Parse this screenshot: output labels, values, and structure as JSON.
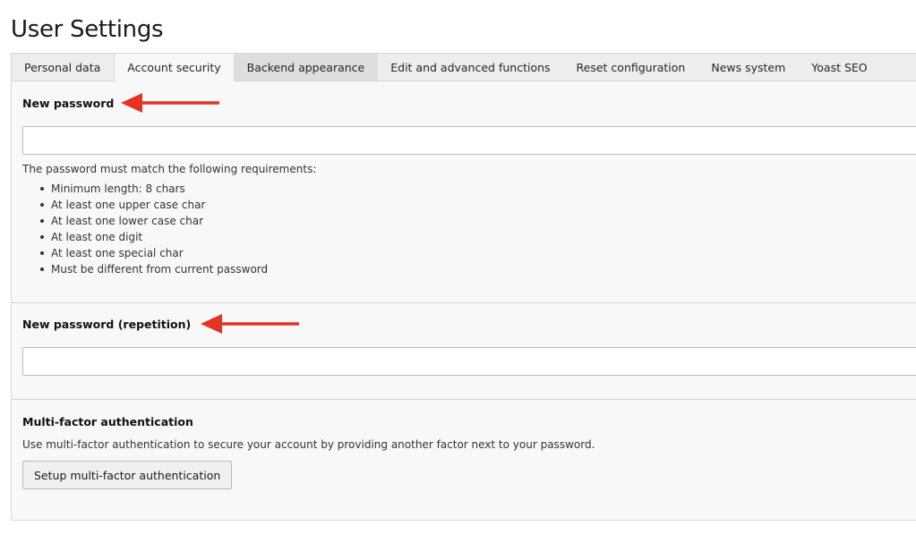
{
  "page": {
    "title": "User Settings"
  },
  "tabs": [
    {
      "label": "Personal data"
    },
    {
      "label": "Account security"
    },
    {
      "label": "Backend appearance"
    },
    {
      "label": "Edit and advanced functions"
    },
    {
      "label": "Reset configuration"
    },
    {
      "label": "News system"
    },
    {
      "label": "Yoast SEO"
    }
  ],
  "active_tab": "Account security",
  "new_password": {
    "label": "New password",
    "value": "",
    "requirements_intro": "The password must match the following requirements:",
    "requirements": [
      "Minimum length: 8 chars",
      "At least one upper case char",
      "At least one lower case char",
      "At least one digit",
      "At least one special char",
      "Must be different from current password"
    ]
  },
  "new_password_repeat": {
    "label": "New password (repetition)",
    "value": ""
  },
  "mfa": {
    "heading": "Multi-factor authentication",
    "description": "Use multi-factor authentication to secure your account by providing another factor next to your password.",
    "button_label": "Setup multi-factor authentication"
  },
  "annotations": {
    "arrow_icon": "left-arrow-icon",
    "arrow_color": "#e53323"
  }
}
